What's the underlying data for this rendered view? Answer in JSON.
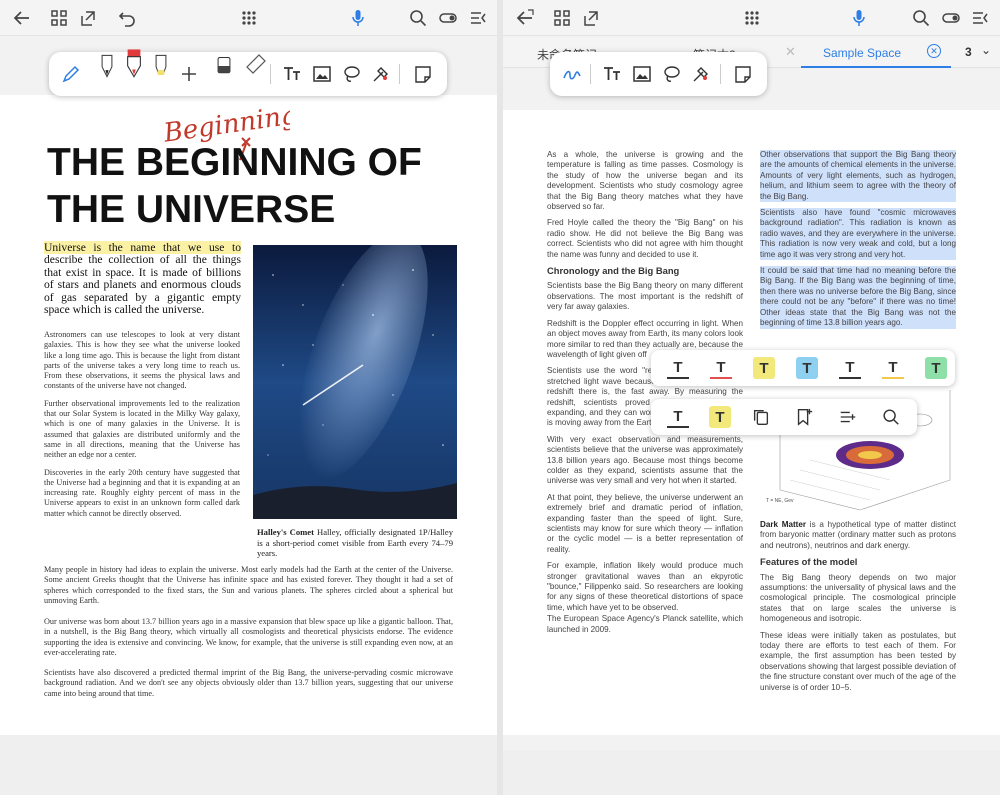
{
  "left": {
    "title_line1": "THE BEGINNING OF",
    "title_line2": "THE UNIVERSE",
    "handwritten": "Beginning",
    "intro_highlight": "Universe is the name that we use to",
    "intro_rest": "describe the collection of all the things that exist in space. It is made of billions of stars and planets and enormous clouds of gas separated by a gigantic empty space which is called the universe.",
    "para1": "Astronomers can use telescopes to look at very distant galaxies. This is how they see what the universe looked like a long time ago. This is because the light from distant parts of the universe takes a very long time to reach us. From these observations, it seems the physical laws and constants of the universe have not changed.",
    "para2": "Further observational improvements led to the realization that our Solar System is located in the Milky Way galaxy, which is one of many galaxies in the Universe. It is assumed that galaxies are distributed uniformly and the same in all directions, meaning that the Universe has neither an edge nor a center.",
    "para3": "Discoveries in the early 20th century have suggested that the Universe had a beginning and that it is expanding at an increasing rate. Roughly eighty percent of mass in the Universe appears to exist in an unknown form called dark matter which cannot be directly observed.",
    "caption_bold": "Halley's Comet",
    "caption_text": "Halley, officially designated 1P/Halley is a short-period comet visible from Earth every 74–79 years.",
    "para4": "Many people in history had ideas to explain the universe. Most early models had the Earth at the center of the Universe. Some ancient Greeks thought that the Universe has infinite space and has existed forever. They thought it had a set of spheres which corresponded to the fixed stars, the Sun and various planets. The spheres circled about a spherical but unmoving Earth.",
    "para5": "Our universe was born about 13.7 billion years ago in a massive expansion that blew space up like a gigantic balloon. That, in a nutshell, is the Big Bang theory, which virtually all cosmologists and theoretical physicists endorse. The evidence supporting the idea is extensive and convincing. We know, for example, that the universe is still expanding even now, at an ever-accelerating rate.",
    "para6": "Scientists have also discovered a predicted thermal imprint of the Big Bang, the universe-pervading cosmic microwave background radiation. And we don't see any objects obviously older than 13.7 billion years, suggesting that our universe came into being around that time."
  },
  "right": {
    "tabs": [
      "未命名笔记",
      "笔记本2",
      "Sample Space"
    ],
    "page_count": "3",
    "colA_p1": "As a whole, the universe is growing and the temperature is falling as time passes. Cosmology is the study of how the universe began and its development. Scientists who study cosmology agree that the Big Bang theory matches what they have observed so far.",
    "colA_p2": "Fred Hoyle called the theory the \"Big Bang\" on his radio show. He did not believe the Big Bang was correct. Scientists who did not agree with him thought the name was funny and decided to use it.",
    "colA_h1": "Chronology and the Big Bang",
    "colA_p3": "Scientists base the Big Bang theory on many different observations. The most important is the redshift of very far away galaxies.",
    "colA_p4": "Redshift is the Doppler effect occurring in light. When an object moves away from Earth, its many colors look more similar to red than they actually are, because the wavelength of light given off",
    "colA_p5": "Scientists use the word \"red shift\" to describe this stretched light wave because the wavelength on the redshift there is, the fast away. By measuring the redshift, scientists proved that the universe is expanding, and they can work out how fast the object is moving away from the Earth.",
    "colA_p6": "With very exact observation and measurements, scientists believe that the universe was approximately 13.8 billion years ago. Because most things become colder as they expand, scientists assume that the universe was very small and very hot when it started.",
    "colA_p7": "At that point, they believe, the universe underwent an extremely brief and dramatic period of inflation, expanding faster than the speed of light. Sure, scientists may know for sure which theory — inflation or the cyclic model — is a better representation of reality.",
    "colA_p8": "For example, inflation likely would produce much stronger gravitational waves than an ekpyrotic \"bounce,\" Filippenko said. So researchers are looking for any signs of these theoretical distortions of space time, which have yet to be observed.",
    "colA_p9": "The European Space Agency's Planck satellite, which launched in 2009.",
    "colB_p1": "Other observations that support the Big Bang theory are the amounts of chemical elements in the universe. Amounts of very light elements, such as hydrogen, helium, and lithium seem to agree with the theory of the Big Bang.",
    "colB_p2": "Scientists also have found \"cosmic microwaves background radiation\". This radiation is known as radio waves, and they are everywhere in the universe. This radiation is now very weak and cold, but a long time ago it was very strong and very hot.",
    "colB_p3": "It could be said that time had no meaning before the Big Bang. If the Big Bang was the beginning of time, then there was no universe before the Big Bang, since there could not be any \"before\" if there was no time! Other ideas state that the Big Bang was not the beginning of time 13.8 billion years ago.",
    "colB_dm_bold": "Dark Matter",
    "colB_dm": "is a hypothetical type of matter distinct from baryonic matter (ordinary matter such as protons and neutrons), neutrinos and dark energy.",
    "colB_h1": "Features of the model",
    "colB_p4": "The Big Bang theory depends on two major assumptions: the universality of physical laws and the cosmological principle. The cosmological principle states that on large scales the universe is homogeneous and isotropic.",
    "colB_p5": "These ideas were initially taken as postulates, but today there are efforts to test each of them. For example, the first assumption has been tested by observations showing that largest possible deviation of the fine structure constant over much of the age of the universe is of order 10−5.",
    "fig_label": "T = NE, Gev",
    "popup_colors": [
      "#333333",
      "#e05050",
      "#f3e97a",
      "#8fcff0",
      "#333333",
      "#f2c94c",
      "#8fe0a8"
    ],
    "popup2_colors": [
      "#333333",
      "#f3e97a"
    ],
    "letter": "T"
  }
}
